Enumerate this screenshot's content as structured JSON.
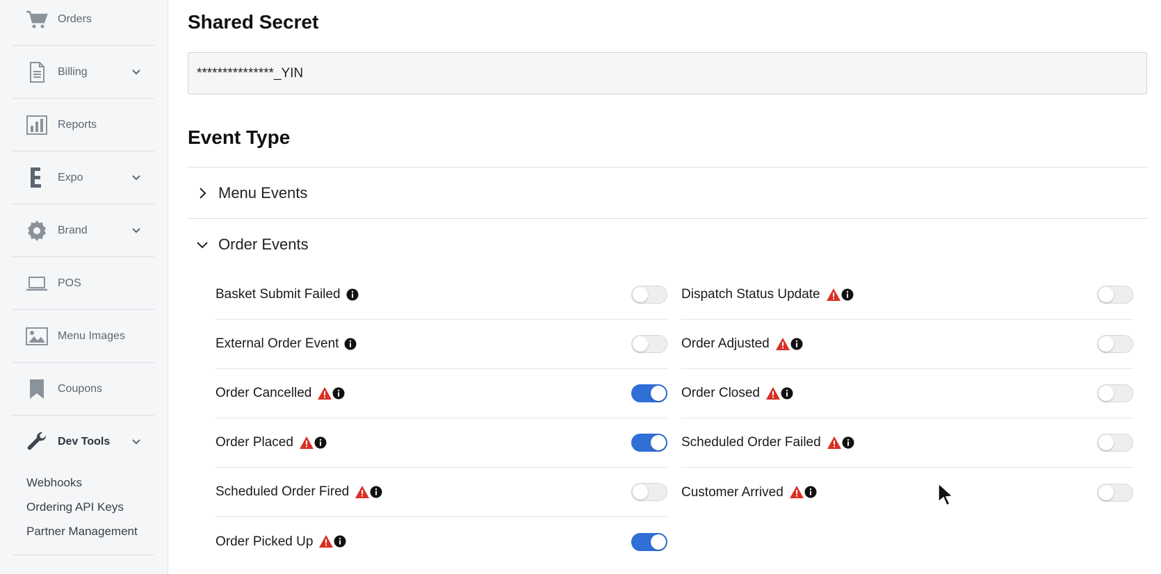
{
  "sidebar": {
    "items": [
      {
        "label": "Orders",
        "icon": "cart-icon"
      },
      {
        "label": "Billing",
        "icon": "document-icon",
        "expandable": true
      },
      {
        "label": "Reports",
        "icon": "bar-chart-icon"
      },
      {
        "label": "Expo",
        "icon": "expo-logo-icon",
        "expandable": true
      },
      {
        "label": "Brand",
        "icon": "gear-icon",
        "expandable": true
      },
      {
        "label": "POS",
        "icon": "laptop-icon"
      },
      {
        "label": "Menu Images",
        "icon": "image-icon"
      },
      {
        "label": "Coupons",
        "icon": "bookmark-icon"
      },
      {
        "label": "Dev Tools",
        "icon": "wrench-icon",
        "expandable": true,
        "expanded": true
      }
    ],
    "subitems": [
      "Webhooks",
      "Ordering API Keys",
      "Partner Management"
    ]
  },
  "main": {
    "shared_secret_heading": "Shared Secret",
    "shared_secret_value": "***************_YIN",
    "event_type_heading": "Event Type",
    "sections": [
      {
        "label": "Menu Events",
        "expanded": false
      },
      {
        "label": "Order Events",
        "expanded": true
      }
    ],
    "order_events_left": [
      {
        "label": "Basket Submit Failed",
        "warning": false,
        "enabled": false
      },
      {
        "label": "External Order Event",
        "warning": false,
        "enabled": false
      },
      {
        "label": "Order Cancelled",
        "warning": true,
        "enabled": true
      },
      {
        "label": "Order Placed",
        "warning": true,
        "enabled": true
      },
      {
        "label": "Scheduled Order Fired",
        "warning": true,
        "enabled": false
      },
      {
        "label": "Order Picked Up",
        "warning": true,
        "enabled": true
      }
    ],
    "order_events_right": [
      {
        "label": "Dispatch Status Update",
        "warning": true,
        "enabled": false
      },
      {
        "label": "Order Adjusted",
        "warning": true,
        "enabled": false
      },
      {
        "label": "Order Closed",
        "warning": true,
        "enabled": false
      },
      {
        "label": "Scheduled Order Failed",
        "warning": true,
        "enabled": false
      },
      {
        "label": "Customer Arrived",
        "warning": true,
        "enabled": false
      }
    ]
  },
  "colors": {
    "toggle_on": "#2f6fd6",
    "warning": "#d93025",
    "sidebar_bg": "#f5f6f7"
  }
}
